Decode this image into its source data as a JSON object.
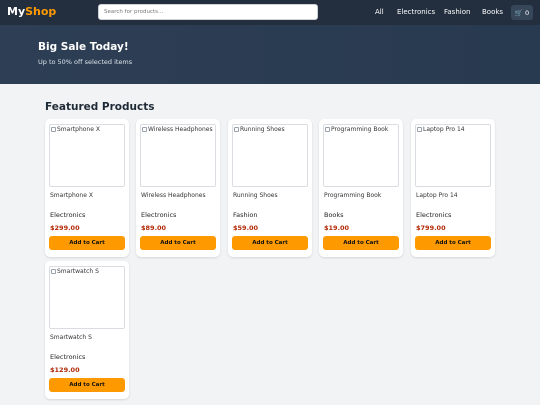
{
  "header": {
    "logo_part1": "My",
    "logo_part2": "Shop",
    "search_placeholder": "Search for products...",
    "nav": [
      "All",
      "Electronics",
      "Fashion",
      "Books"
    ],
    "cart_count": "0",
    "cart_icon": "cart-icon"
  },
  "hero": {
    "title": "Big Sale Today!",
    "subtitle": "Up to 50% off selected items"
  },
  "section_title": "Featured Products",
  "products": [
    {
      "alt": "Smartphone X",
      "name": "Smartphone X",
      "category": "Electronics",
      "price": "$299.00",
      "button": "Add to Cart"
    },
    {
      "alt": "Wireless Headphones",
      "name": "Wireless Headphones",
      "category": "Electronics",
      "price": "$89.00",
      "button": "Add to Cart"
    },
    {
      "alt": "Running Shoes",
      "name": "Running Shoes",
      "category": "Fashion",
      "price": "$59.00",
      "button": "Add to Cart"
    },
    {
      "alt": "Programming Book",
      "name": "Programming Book",
      "category": "Books",
      "price": "$19.00",
      "button": "Add to Cart"
    },
    {
      "alt": "Laptop Pro 14",
      "name": "Laptop Pro 14",
      "category": "Electronics",
      "price": "$799.00",
      "button": "Add to Cart"
    },
    {
      "alt": "Smartwatch S",
      "name": "Smartwatch S",
      "category": "Electronics",
      "price": "$129.00",
      "button": "Add to Cart"
    }
  ],
  "colors": {
    "header_bg": "#232f3e",
    "accent": "#ff9900",
    "price": "#b12704"
  }
}
